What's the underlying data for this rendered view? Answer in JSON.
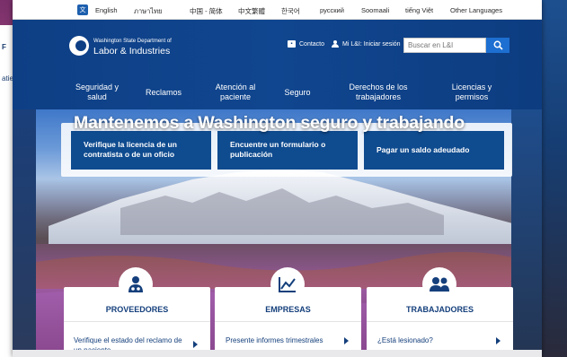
{
  "language_bar": {
    "languages": [
      "English",
      "ภาษาไทย",
      "中国 - 简体",
      "中文繁體",
      "한국어",
      "русский",
      "Soomaali",
      "tiếng Việt",
      "Other Languages"
    ]
  },
  "header": {
    "logo_small": "Washington State Department of",
    "logo_big": "Labor & Industries",
    "contact_label": "Contacto",
    "login_label": "Mi L&I: Iniciar sesión",
    "search_placeholder": "Buscar en L&I"
  },
  "nav": [
    {
      "label": "Seguridad y salud"
    },
    {
      "label": "Reclamos"
    },
    {
      "label": "Atención al paciente"
    },
    {
      "label": "Seguro"
    },
    {
      "label": "Derechos de los trabajadores"
    },
    {
      "label": "Licencias y permisos"
    }
  ],
  "quick_links": [
    {
      "label": "Verifique la licencia de un contratista o de un oficio"
    },
    {
      "label": "Encuentre un formulario o publicación"
    },
    {
      "label": "Pagar un saldo adeudado"
    }
  ],
  "hero": {
    "title": "Mantenemos a Washington seguro y trabajando"
  },
  "cards": [
    {
      "title": "PROVEEDORES",
      "icon": "doctor-icon",
      "link": "Verifique el estado del reclamo de un paciente"
    },
    {
      "title": "EMPRESAS",
      "icon": "chart-line-icon",
      "link": "Presente informes trimestrales"
    },
    {
      "title": "TRABAJADORES",
      "icon": "people-icon",
      "link": "¿Está lesionado?"
    }
  ],
  "background_fragments": [
    "F",
    "atie"
  ],
  "colors": {
    "header_blue": "#0e3f85",
    "button_blue": "#0f4b8f",
    "search_button": "#1d6fd1",
    "card_text": "#143f7c"
  }
}
